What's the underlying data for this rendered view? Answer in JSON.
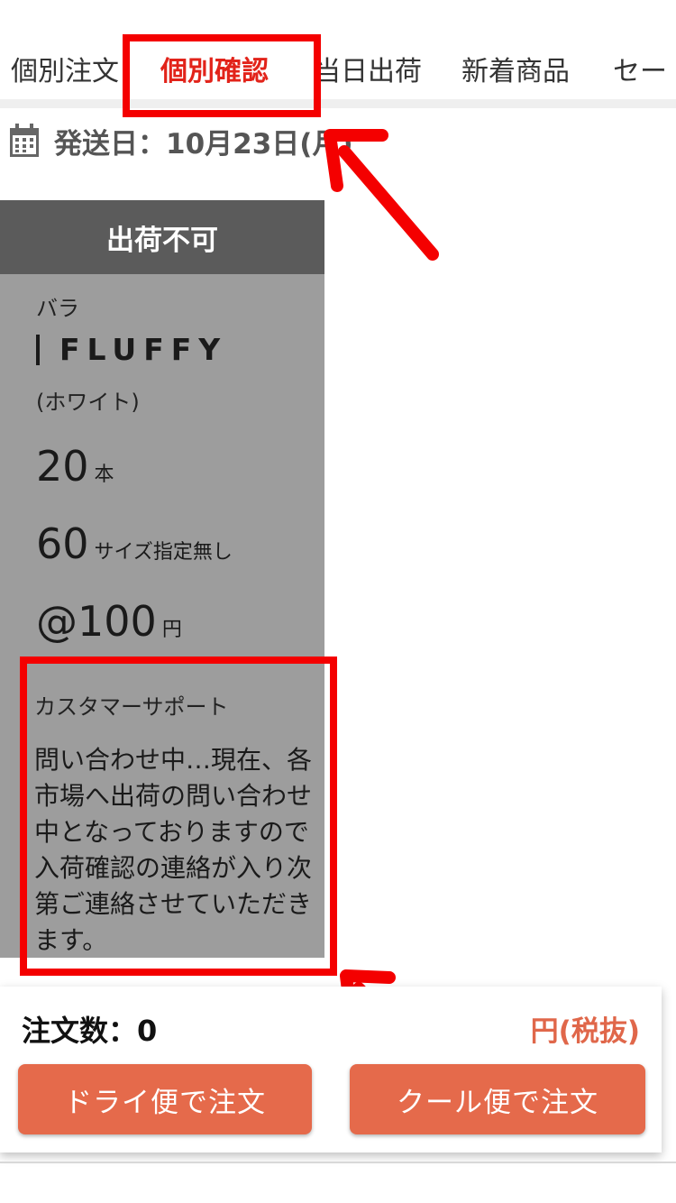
{
  "tabs": [
    {
      "label": "個別注文",
      "active": false
    },
    {
      "label": "個別確認",
      "active": true
    },
    {
      "label": "当日出荷",
      "active": false
    },
    {
      "label": "新着商品",
      "active": false
    },
    {
      "label": "セー",
      "active": false
    }
  ],
  "ship_date": {
    "text": "発送日：10月23日(月)",
    "icon": "calendar-icon"
  },
  "card": {
    "status": "出荷不可",
    "category": "バラ",
    "name": "FLUFFY",
    "color": "(ホワイト)",
    "quantity": {
      "value": "20",
      "unit": "本"
    },
    "size": {
      "value": "60",
      "unit": "サイズ指定無し"
    },
    "price": {
      "value": "@100",
      "unit": "円"
    },
    "support": {
      "title": "カスタマーサポート",
      "message": "問い合わせ中…現在、各市場へ出荷の問い合わせ中となっておりますので入荷確認の連絡が入り次第ご連絡させていただきます。"
    }
  },
  "order_bar": {
    "count_label": "注文数：0",
    "price_label": "円(税抜)",
    "dry_button": "ドライ便で注文",
    "cool_button": "クール便で注文"
  },
  "colors": {
    "accent": "#e2231a",
    "button": "#e56a4b",
    "card_bg": "#9d9d9d",
    "card_header": "#5b5b5b",
    "annotation": "#f40000"
  }
}
